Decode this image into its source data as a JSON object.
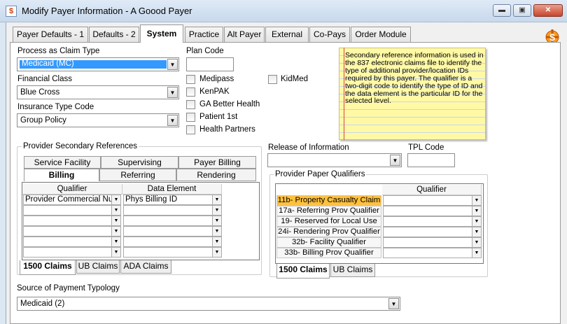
{
  "window": {
    "title": "Modify Payer Information - A Goood Payer",
    "app_icon": "payer-icon",
    "controls": {
      "minimize": "▬",
      "maximize": "▣",
      "close": "✕"
    }
  },
  "tabs": [
    {
      "label": "Payer Defaults - 1"
    },
    {
      "label": "Defaults - 2"
    },
    {
      "label": "System"
    },
    {
      "label": "Practice"
    },
    {
      "label": "Alt Payer"
    },
    {
      "label": "External"
    },
    {
      "label": "Co-Pays"
    },
    {
      "label": "Order Module"
    }
  ],
  "form": {
    "process_claim_type_label": "Process as Claim Type",
    "process_claim_type_value": "Medicaid  (MC)",
    "financial_class_label": "Financial Class",
    "financial_class_value": "Blue Cross",
    "insurance_type_label": "Insurance Type Code",
    "insurance_type_value": "Group Policy",
    "plan_code_label": "Plan Code",
    "checkboxes": [
      {
        "label": "Medipass"
      },
      {
        "label": "KenPAK"
      },
      {
        "label": "GA Better Health"
      },
      {
        "label": "Patient 1st"
      },
      {
        "label": "Health Partners"
      }
    ],
    "kidmed_label": "KidMed",
    "release_label": "Release of Information",
    "tpl_label": "TPL Code",
    "source_label": "Source of Payment Typology",
    "source_value": "Medicaid  (2)"
  },
  "note": {
    "text": "Secondary reference information is used in the 837 electronic claims file to identify the type of additional provider/location IDs required by this payer.  The qualifier is a two-digit code to identify the type of ID and the data element is the particular ID for the selected level."
  },
  "secondary_refs": {
    "title": "Provider Secondary References",
    "subtabs_row1": [
      "Service Facility",
      "Supervising",
      "Payer Billing"
    ],
    "subtabs_row2": [
      "Billing",
      "Referring",
      "Rendering"
    ],
    "columns": [
      "Qualifier",
      "Data Element"
    ],
    "rows": [
      {
        "qualifier": "Provider Commercial Numl",
        "element": "Phys Billing ID"
      },
      {
        "qualifier": "",
        "element": ""
      },
      {
        "qualifier": "",
        "element": ""
      },
      {
        "qualifier": "",
        "element": ""
      },
      {
        "qualifier": "",
        "element": ""
      },
      {
        "qualifier": "",
        "element": ""
      }
    ],
    "bottom_tabs": [
      "1500 Claims",
      "UB Claims",
      "ADA Claims"
    ]
  },
  "paper_qualifiers": {
    "title": "Provider Paper Qualifiers",
    "column": "Qualifier",
    "rows": [
      {
        "label": "11b- Property Casualty Claim",
        "value": ""
      },
      {
        "label": "17a- Referring Prov Qualifier",
        "value": ""
      },
      {
        "label": "19- Reserved for Local Use",
        "value": ""
      },
      {
        "label": "24i- Rendering Prov Qualifier",
        "value": ""
      },
      {
        "label": "32b- Facility Qualifier",
        "value": ""
      },
      {
        "label": "33b- Billing Prov Qualifier",
        "value": ""
      }
    ],
    "bottom_tabs": [
      "1500 Claims",
      "UB Claims"
    ]
  },
  "dropdown_glyph": "▼",
  "side_icon": "caduceus-dollar-icon"
}
